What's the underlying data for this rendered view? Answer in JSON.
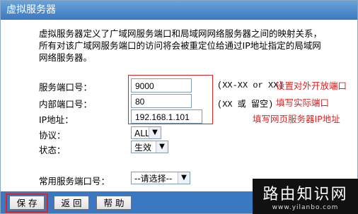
{
  "window": {
    "title": "虚拟服务器"
  },
  "description": [
    "虚拟服务器定义了广域网服务端口和局域网网络服务器之间的映射关系，",
    "所有对该广域网服务端口的访问将会被重定位给通过IP地址指定的局域网",
    "网络服务器。"
  ],
  "form": {
    "service_port": {
      "label": "服务端口号：",
      "value": "9000",
      "hint": "(XX-XX or XX)",
      "annotation": "设置对外开放端口"
    },
    "internal_port": {
      "label": "内部端口号：",
      "value": "80",
      "hint": "(XX 或 留空)",
      "annotation": "填写实际端口"
    },
    "ip_address": {
      "label": "IP地址：",
      "value": "192.168.1.101",
      "annotation": "填写网页服务器IP地址"
    },
    "protocol": {
      "label": "协议：",
      "value": "ALL"
    },
    "status": {
      "label": "状态：",
      "value": "生效"
    },
    "common_port": {
      "label": "常用服务端口号：",
      "value": "--请选择--"
    }
  },
  "buttons": {
    "save": "保 存",
    "back": "返 回",
    "help": "帮 助"
  },
  "watermark": {
    "name": "路由知识网",
    "url": "www.yilanbo.com"
  },
  "colors": {
    "title_bar": "#4a86cc",
    "annotation": "#e02222",
    "bottom_bar": "#3a78c1"
  }
}
